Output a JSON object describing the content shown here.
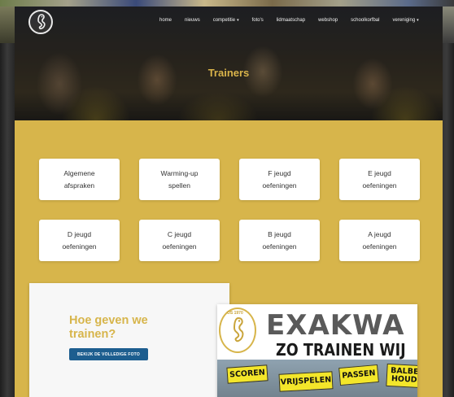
{
  "nav": {
    "items": [
      {
        "label": "home"
      },
      {
        "label": "nieuws"
      },
      {
        "label": "competitie",
        "caret": "▾"
      },
      {
        "label": "foto's"
      },
      {
        "label": "lidmaatschap"
      },
      {
        "label": "webshop"
      },
      {
        "label": "schoolkorfbal"
      },
      {
        "label": "vereniging",
        "caret": "▾"
      }
    ]
  },
  "hero": {
    "title": "Trainers"
  },
  "cards": [
    {
      "label": "Algemene\nafspraken"
    },
    {
      "label": "Warming-up\nspellen"
    },
    {
      "label": "F jeugd\noefeningen"
    },
    {
      "label": "E jeugd\noefeningen"
    },
    {
      "label": "D jeugd\noefeningen"
    },
    {
      "label": "C jeugd\noefeningen"
    },
    {
      "label": "B jeugd\noefeningen"
    },
    {
      "label": "A jeugd\noefeningen"
    }
  ],
  "panel": {
    "title": "Hoe geven we trainen?",
    "button_label": "BEKIJK DE VOLLEDIGE FOTO"
  },
  "poster": {
    "seal_year": "OS 1970",
    "headline": "EXAKWA",
    "subheadline": "ZO TRAINEN WIJ",
    "signs": [
      "SCOREN",
      "VRIJSPELEN",
      "PASSEN",
      "BALBE\nHOUD"
    ]
  },
  "colors": {
    "accent": "#d7b54b",
    "button": "#1d5e8f",
    "hero_title": "#d9b44a"
  }
}
